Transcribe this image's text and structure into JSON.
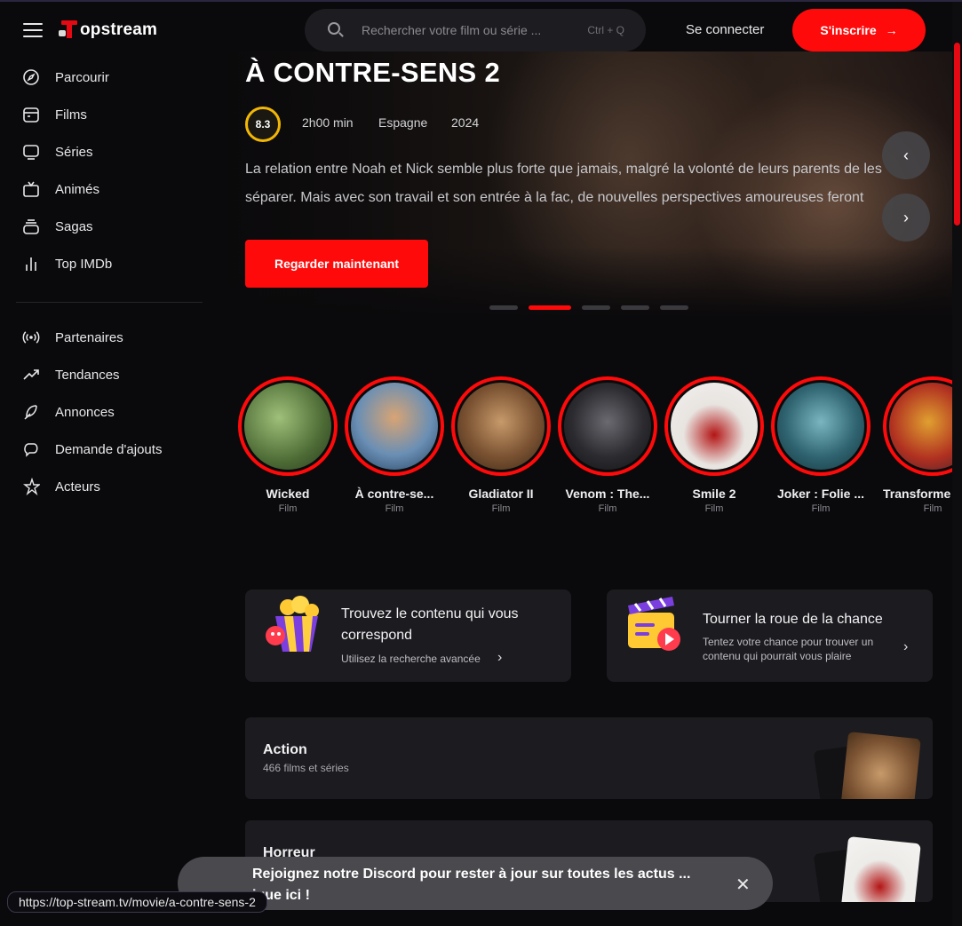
{
  "header": {
    "brand": "opstream",
    "search_placeholder": "Rechercher votre film ou série ...",
    "search_shortcut": "Ctrl + Q",
    "login_label": "Se connecter",
    "signup_label": "S'inscrire"
  },
  "sidebar": {
    "primary": [
      {
        "label": "Parcourir",
        "icon": "compass-icon"
      },
      {
        "label": "Films",
        "icon": "calendar-icon"
      },
      {
        "label": "Séries",
        "icon": "monitor-icon"
      },
      {
        "label": "Animés",
        "icon": "tv-icon"
      },
      {
        "label": "Sagas",
        "icon": "stack-icon"
      },
      {
        "label": "Top IMDb",
        "icon": "bar-chart-icon"
      }
    ],
    "secondary": [
      {
        "label": "Partenaires",
        "icon": "broadcast-icon"
      },
      {
        "label": "Tendances",
        "icon": "trending-icon"
      },
      {
        "label": "Annonces",
        "icon": "feather-icon"
      },
      {
        "label": "Demande d'ajouts",
        "icon": "chat-icon"
      },
      {
        "label": "Acteurs",
        "icon": "star-icon"
      }
    ]
  },
  "hero": {
    "title": "À CONTRE-SENS 2",
    "rating": "8.3",
    "duration": "2h00 min",
    "country": "Espagne",
    "year": "2024",
    "description": "La relation entre Noah et Nick semble plus forte que jamais, malgré la volonté de leurs parents de les séparer. Mais avec son travail et son entrée à la fac, de nouvelles perspectives amoureuses feront",
    "watch_label": "Regarder maintenant",
    "slides_total": 5,
    "slide_active": 2
  },
  "stories": [
    {
      "title": "Wicked",
      "type": "Film"
    },
    {
      "title": "À contre-se...",
      "type": "Film"
    },
    {
      "title": "Gladiator II",
      "type": "Film"
    },
    {
      "title": "Venom : The...",
      "type": "Film"
    },
    {
      "title": "Smile 2",
      "type": "Film"
    },
    {
      "title": "Joker : Folie ...",
      "type": "Film"
    },
    {
      "title": "Transforme",
      "type": "Film"
    }
  ],
  "features": {
    "search": {
      "title": "Trouvez le contenu qui vous correspond",
      "link": "Utilisez la recherche avancée"
    },
    "wheel": {
      "title": "Tourner la roue de la chance",
      "desc": "Tentez votre chance pour trouver un contenu qui pourrait vous plaire"
    }
  },
  "genres": [
    {
      "name": "Action",
      "count": "466 films et séries"
    },
    {
      "name": "Horreur",
      "count": ""
    }
  ],
  "toast": {
    "text": "Rejoignez notre Discord pour rester à jour sur toutes les actus ... ique ici !"
  },
  "status_url": "https://top-stream.tv/movie/a-contre-sens-2",
  "colors": {
    "accent": "#ff0a0a",
    "rating_ring": "#f2b705",
    "background": "#0a090b",
    "card": "#1c1b1f"
  }
}
